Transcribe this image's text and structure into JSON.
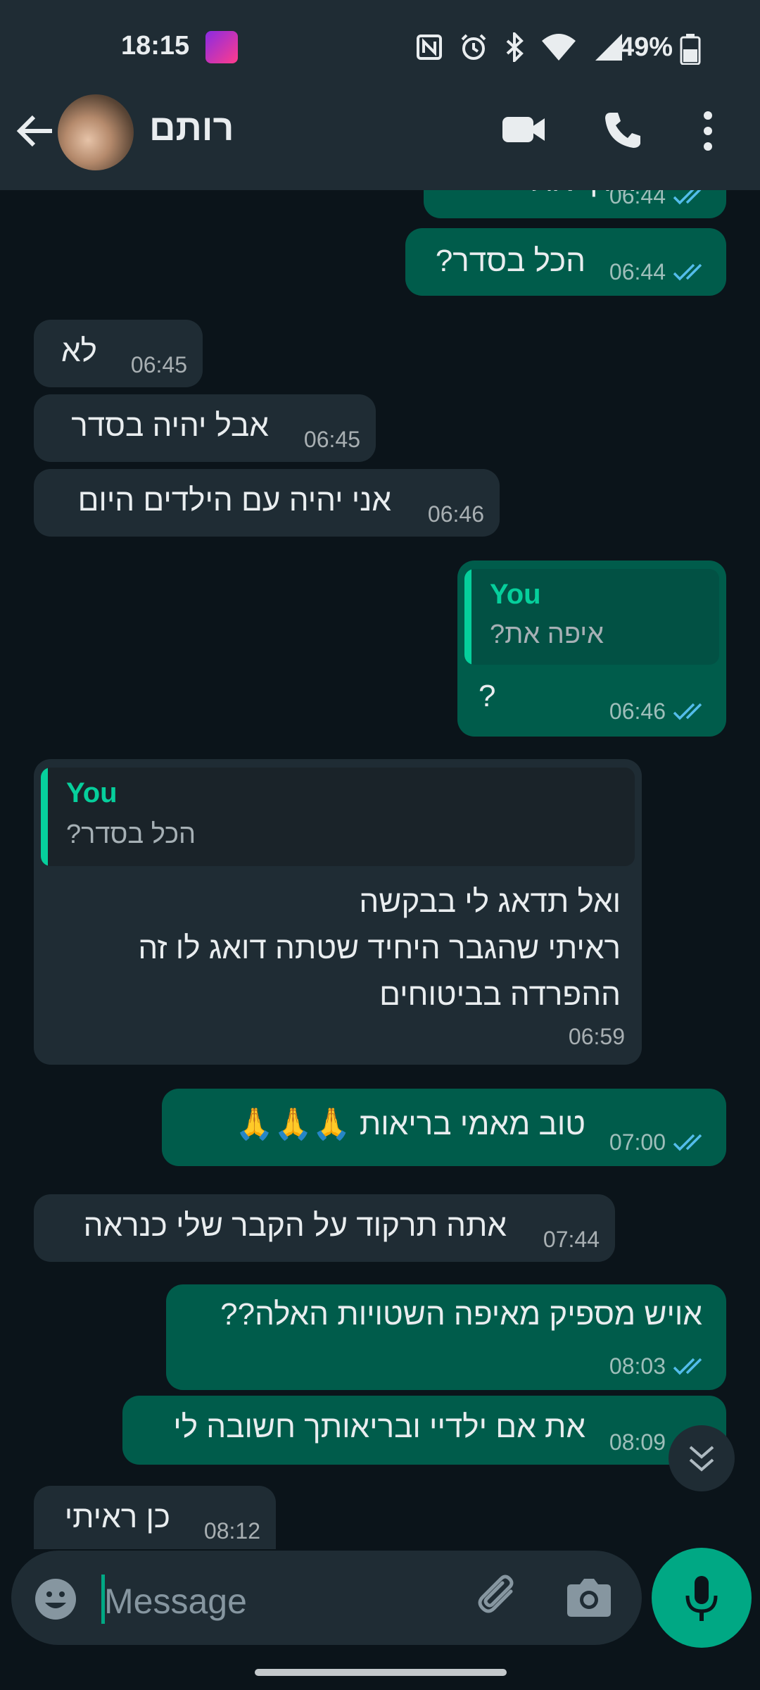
{
  "status_bar": {
    "time": "18:15",
    "battery": "49%"
  },
  "header": {
    "contact_name": "רותם",
    "avatar_label": "contact photo"
  },
  "messages": [
    {
      "id": "m0",
      "dir": "out",
      "text": "?איך את",
      "time": "06:44",
      "read": true
    },
    {
      "id": "m1",
      "dir": "out",
      "text": "הכל בסדר?",
      "time": "06:44",
      "read": true
    },
    {
      "id": "m2",
      "dir": "in",
      "text": "לא",
      "time": "06:45"
    },
    {
      "id": "m3",
      "dir": "in",
      "text": "אבל יהיה בסדר",
      "time": "06:45"
    },
    {
      "id": "m4",
      "dir": "in",
      "text": "אני יהיה עם הילדים היום",
      "time": "06:46"
    },
    {
      "id": "m5",
      "dir": "out",
      "quote_name": "You",
      "quote_text": "איפה את?",
      "text": "?",
      "time": "06:46",
      "read": true
    },
    {
      "id": "m6",
      "dir": "in",
      "quote_name": "You",
      "quote_text": "הכל בסדר?",
      "lines": [
        "ואל תדאג לי בבקשה",
        "ראיתי שהגבר היחיד שטתה דואג לו זה",
        "ההפרדה בביטוחים"
      ],
      "time": "06:59"
    },
    {
      "id": "m7",
      "dir": "out",
      "text": "טוב מאמי בריאות 🙏🙏🙏",
      "time": "07:00",
      "read": true
    },
    {
      "id": "m8",
      "dir": "in",
      "text": "אתה תרקוד על הקבר שלי כנראה",
      "time": "07:44"
    },
    {
      "id": "m9",
      "dir": "out",
      "text": "אויש מספיק מאיפה השטויות האלה??",
      "time": "08:03",
      "read": true
    },
    {
      "id": "m10",
      "dir": "out",
      "text": "את אם ילדיי ובריאותך חשובה לי",
      "time": "08:09",
      "read": true
    },
    {
      "id": "m11",
      "dir": "in",
      "text": "כן ראיתי",
      "time": "08:12"
    }
  ],
  "composer": {
    "placeholder": "Message"
  },
  "colors": {
    "outgoing": "#005c4b",
    "incoming": "#1f2c34",
    "accent": "#00a884",
    "background": "#0b141a"
  },
  "icons": [
    "back-arrow-icon",
    "video-call-icon",
    "voice-call-icon",
    "more-options-icon",
    "emoji-icon",
    "attach-icon",
    "camera-icon",
    "mic-icon",
    "chevron-double-down-icon",
    "read-ticks-icon"
  ]
}
